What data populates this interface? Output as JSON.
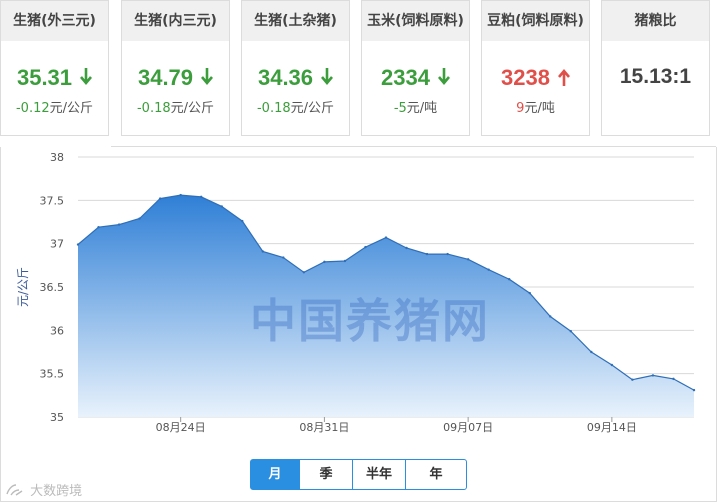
{
  "cards": [
    {
      "name": "生猪(外三元)",
      "price": "35.31",
      "direction": "down",
      "change": "-0.12",
      "unit": "元/公斤"
    },
    {
      "name": "生猪(内三元)",
      "price": "34.79",
      "direction": "down",
      "change": "-0.18",
      "unit": "元/公斤"
    },
    {
      "name": "生猪(土杂猪)",
      "price": "34.36",
      "direction": "down",
      "change": "-0.18",
      "unit": "元/公斤"
    },
    {
      "name": "玉米(饲料原料)",
      "price": "2334",
      "direction": "down",
      "change": "-5",
      "unit": "元/吨"
    },
    {
      "name": "豆粕(饲料原料)",
      "price": "3238",
      "direction": "up",
      "change": "9",
      "unit": "元/吨"
    },
    {
      "name": "猪粮比",
      "ratio": "15.13:1"
    }
  ],
  "colors": {
    "down": "#3c9d3c",
    "up": "#e0504a",
    "accent": "#2a8fe0",
    "area_top": "#2f7fd6",
    "area_bottom": "#e8f2fc"
  },
  "watermark": "中国养猪网",
  "range_tabs": [
    "月",
    "季",
    "半年",
    "年"
  ],
  "range_selected": "月",
  "brand": "大数跨境",
  "chart_data": {
    "type": "area",
    "ylabel": "元/公斤",
    "ylim": [
      35,
      38
    ],
    "yticks": [
      "35",
      "35.5",
      "36",
      "36.5",
      "37",
      "37.5",
      "38"
    ],
    "xticks": [
      "08月24日",
      "08月31日",
      "09月07日",
      "09月14日"
    ],
    "x": [
      "08月19日",
      "08月20日",
      "08月21日",
      "08月22日",
      "08月23日",
      "08月24日",
      "08月25日",
      "08月26日",
      "08月27日",
      "08月28日",
      "08月29日",
      "08月30日",
      "08月31日",
      "09月01日",
      "09月02日",
      "09月03日",
      "09月04日",
      "09月05日",
      "09月06日",
      "09月07日",
      "09月08日",
      "09月09日",
      "09月10日",
      "09月11日",
      "09月12日",
      "09月13日",
      "09月14日",
      "09月15日",
      "09月16日",
      "09月17日",
      "09月18日"
    ],
    "values": [
      36.99,
      37.19,
      37.22,
      37.29,
      37.52,
      37.56,
      37.54,
      37.43,
      37.26,
      36.91,
      36.84,
      36.67,
      36.79,
      36.8,
      36.96,
      37.07,
      36.95,
      36.88,
      36.88,
      36.82,
      36.7,
      36.59,
      36.43,
      36.16,
      35.99,
      35.75,
      35.6,
      35.43,
      35.48,
      35.44,
      35.31
    ],
    "grid": true
  }
}
